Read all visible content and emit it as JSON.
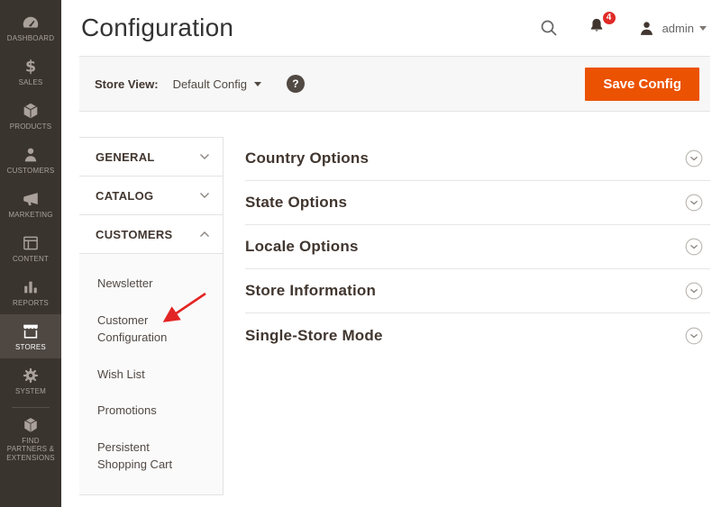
{
  "page_title": "Configuration",
  "header": {
    "notification_count": "4",
    "user_name": "admin"
  },
  "toolbar": {
    "store_view_label": "Store View:",
    "store_view_value": "Default Config",
    "help_glyph": "?",
    "save_button_label": "Save Config"
  },
  "sidebar": {
    "active_item": "STORES",
    "items": [
      {
        "label": "DASHBOARD",
        "icon": "dashboard-icon"
      },
      {
        "label": "SALES",
        "icon": "sales-icon"
      },
      {
        "label": "PRODUCTS",
        "icon": "products-icon"
      },
      {
        "label": "CUSTOMERS",
        "icon": "customers-icon"
      },
      {
        "label": "MARKETING",
        "icon": "marketing-icon"
      },
      {
        "label": "CONTENT",
        "icon": "content-icon"
      },
      {
        "label": "REPORTS",
        "icon": "reports-icon"
      },
      {
        "label": "STORES",
        "icon": "stores-icon"
      },
      {
        "label": "SYSTEM",
        "icon": "system-icon"
      },
      {
        "label": "FIND PARTNERS & EXTENSIONS",
        "icon": "find-partners-icon"
      }
    ]
  },
  "config_nav": {
    "sections": [
      {
        "label": "GENERAL",
        "state": "collapsed"
      },
      {
        "label": "CATALOG",
        "state": "collapsed"
      },
      {
        "label": "CUSTOMERS",
        "state": "expanded",
        "items": [
          "Newsletter",
          "Customer Configuration",
          "Wish List",
          "Promotions",
          "Persistent Shopping Cart"
        ]
      }
    ]
  },
  "accordion": {
    "sections": [
      {
        "title": "Country Options"
      },
      {
        "title": "State Options"
      },
      {
        "title": "Locale Options"
      },
      {
        "title": "Store Information"
      },
      {
        "title": "Single-Store Mode"
      }
    ]
  },
  "annotation": {
    "type": "red-arrow",
    "points_to": "Customer Configuration"
  },
  "colors": {
    "accent_orange": "#eb5202",
    "badge_red": "#e02b27",
    "arrow_red": "#e32424",
    "sidebar_bg": "#3a342f",
    "sidebar_active_bg": "#4e4742"
  }
}
